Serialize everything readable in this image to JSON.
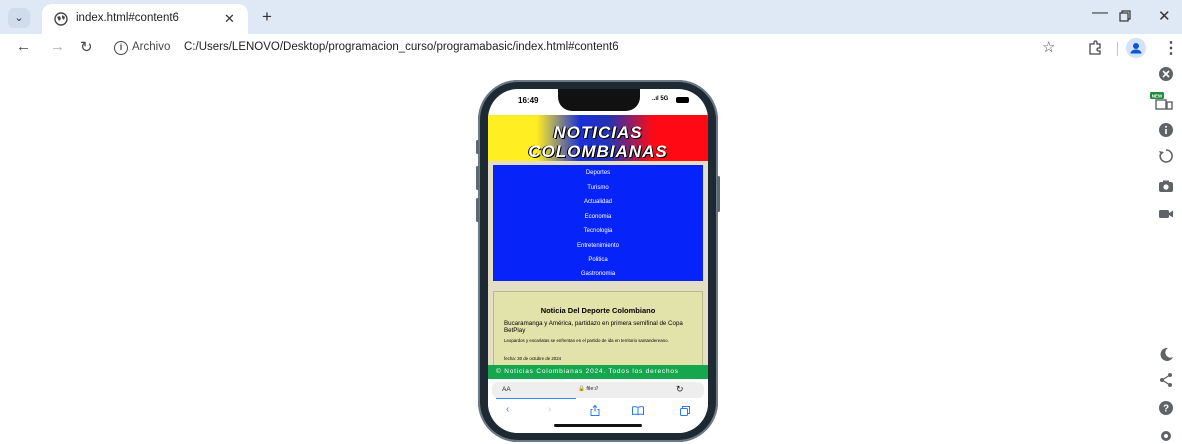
{
  "browser": {
    "tab_title": "index.html#content6",
    "address_chip": "Archivo",
    "url": "C:/Users/LENOVO/Desktop/programacion_curso/programabasic/index.html#content6",
    "accent": "#dfe9f6"
  },
  "phone": {
    "time": "16:49",
    "signal": "..ıl 5G",
    "site_title_line1": "NOTICIAS",
    "site_title_line2": "COLOMBIANAS",
    "nav": [
      "Deportes",
      "Turismo",
      "Actualidad",
      "Economia",
      "Tecnologia",
      "Entretenimiento",
      "Politica",
      "Gastronomia"
    ],
    "article": {
      "title": "Noticia Del Deporte Colombiano",
      "lead": "Bucaramanga y América, partidazo en primera semifinal de Copa BetPlay",
      "text": "Leopardos y escarlatas se enfrentan en el partido de ida en territorio santandereano.",
      "date": "fecha: 30 de octubre de 2024"
    },
    "footer": "© Noticias Colombianas 2024. Todos los derechos",
    "safari_aa": "AA",
    "safari_url": "file://",
    "colors": {
      "nav": "#0623f9",
      "footer": "#16a64e",
      "body": "#e4dfc4",
      "article": "#e2e3aa"
    }
  }
}
